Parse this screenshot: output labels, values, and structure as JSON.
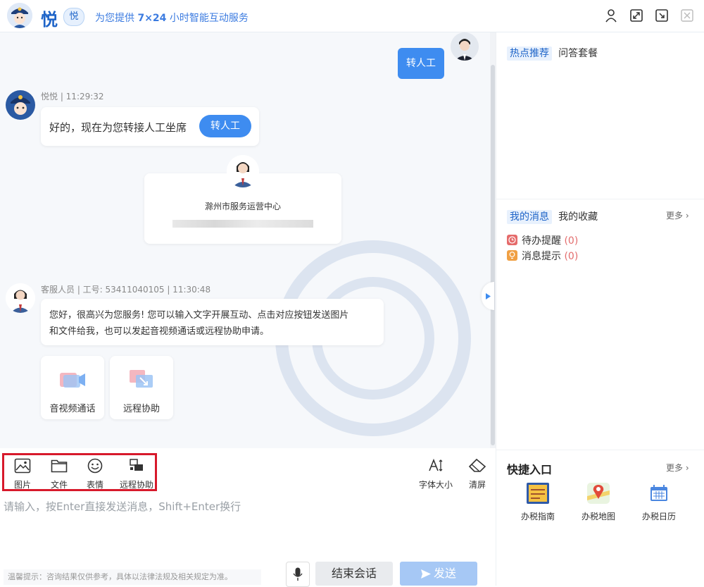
{
  "header": {
    "brand": "悦",
    "brand_badge": "悦",
    "slogan_prefix": "为您提供",
    "slogan_strong": "7×24",
    "slogan_suffix": "小时智能互动服务"
  },
  "chat": {
    "user_message": "转人工",
    "bot": {
      "name_time": "悦悦 | 11:29:32",
      "message": "好的，现在为您转接人工坐席",
      "button": "转人工"
    },
    "center_card": {
      "org_name": "滁州市服务运营中心"
    },
    "agent": {
      "name_time": "客服人员 | 工号: 53411040105 | 11:30:48",
      "message_line1": "您好，很高兴为您服务! 您可以输入文字开展互动、点击对应按钮发送图片",
      "message_line2": "和文件给我，也可以发起音视频通话或远程协助申请。",
      "tiles": [
        {
          "label": "音视频通话",
          "icon": "video-call-icon"
        },
        {
          "label": "远程协助",
          "icon": "remote-assist-icon"
        }
      ]
    }
  },
  "toolbar": {
    "tools": [
      {
        "label": "图片",
        "icon": "image-icon"
      },
      {
        "label": "文件",
        "icon": "folder-icon"
      },
      {
        "label": "表情",
        "icon": "emoji-icon"
      },
      {
        "label": "远程协助",
        "icon": "remote-assist-icon"
      }
    ],
    "font_size": "字体大小",
    "clear": "清屏"
  },
  "input": {
    "placeholder": "请输入，按Enter直接发送消息，Shift+Enter换行"
  },
  "footer": {
    "tip": "温馨提示：咨询结果仅供参考，具体以法律法规及相关规定为准。",
    "end_button": "结束会话",
    "send_button": "发送"
  },
  "right": {
    "hot_tabs": [
      "热点推荐",
      "问答套餐"
    ],
    "msg_tabs": [
      "我的消息",
      "我的收藏"
    ],
    "more": "更多 ›",
    "messages": [
      {
        "label": "待办提醒",
        "count": "(0)",
        "color": "#e56b6b"
      },
      {
        "label": "消息提示",
        "count": "(0)",
        "color": "#f0a044"
      }
    ],
    "quick_title": "快捷入口",
    "quick_items": [
      {
        "label": "办税指南",
        "icon_text": "办税指南"
      },
      {
        "label": "办税地图"
      },
      {
        "label": "办税日历"
      }
    ]
  },
  "colors": {
    "accent": "#3e8cf0",
    "brand": "#1e64c8",
    "highlight": "#d7192b"
  }
}
